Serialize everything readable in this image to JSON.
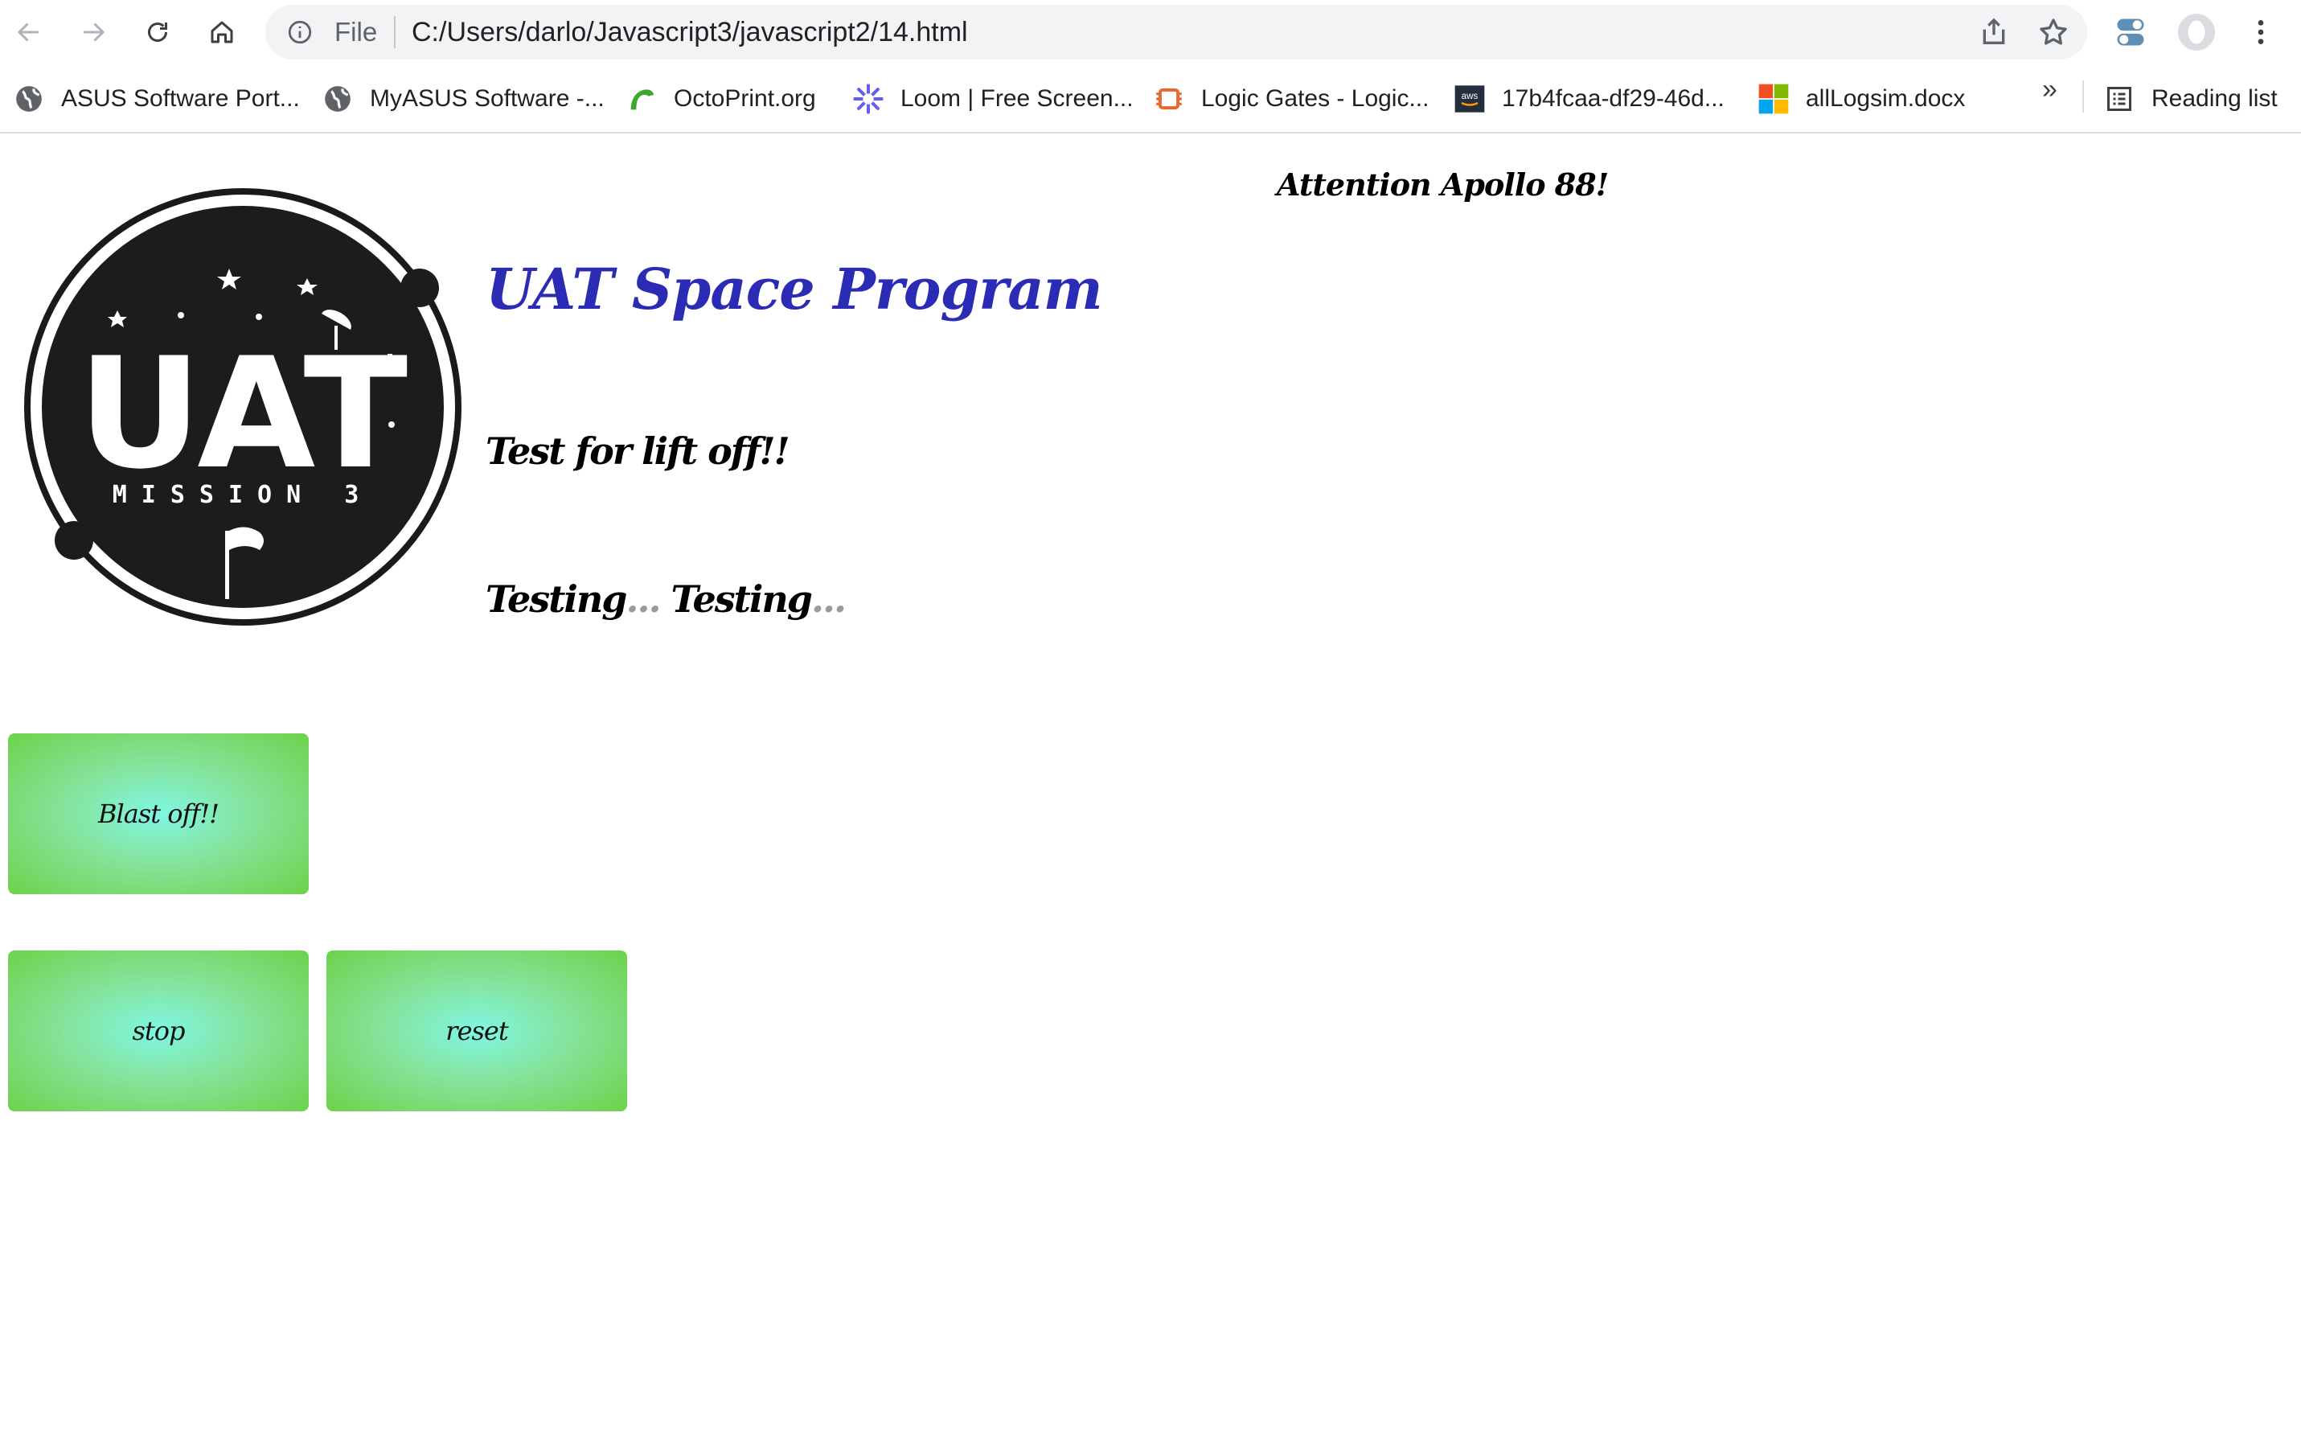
{
  "browser": {
    "url_scheme": "File",
    "url": "C:/Users/darlo/Javascript3/javascript2/14.html",
    "more_bookmarks": "»",
    "reading_list": "Reading list",
    "bookmarks": [
      {
        "label": "ASUS Software Port...",
        "icon": "globe-icon"
      },
      {
        "label": "MyASUS Software -...",
        "icon": "globe-icon"
      },
      {
        "label": "OctoPrint.org",
        "icon": "octoprint-icon"
      },
      {
        "label": "Loom | Free Screen...",
        "icon": "loom-icon"
      },
      {
        "label": "Logic Gates - Logic...",
        "icon": "chip-icon"
      },
      {
        "label": "17b4fcaa-df29-46d...",
        "icon": "aws-icon"
      },
      {
        "label": "allLogsim.docx",
        "icon": "microsoft-icon"
      }
    ]
  },
  "logo": {
    "main_text": "UAT",
    "sub_text": "MISSION 3"
  },
  "page": {
    "attention": "Attention Apollo 88!",
    "title": "UAT Space Program",
    "subtitle": "Test for lift off!!",
    "testing_1": "Testing",
    "dots_1": "...",
    "testing_2": " Testing",
    "dots_2": "..."
  },
  "buttons": {
    "blast": "Blast off!!",
    "stop": "stop",
    "reset": "reset"
  },
  "colors": {
    "title": "#2b2bb5",
    "button_center": "#7ff7e3",
    "button_edge": "#6dd24a"
  }
}
